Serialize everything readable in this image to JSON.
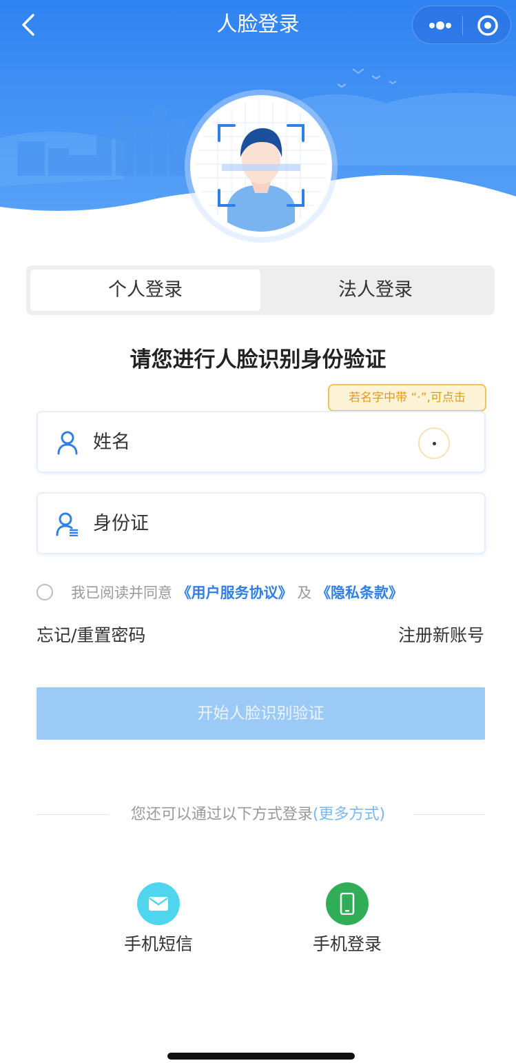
{
  "nav": {
    "title": "人脸登录"
  },
  "tabs": [
    {
      "label": "个人登录",
      "selected": true
    },
    {
      "label": "法人登录",
      "selected": false
    }
  ],
  "heading": "请您进行人脸识别身份验证",
  "tooltip": {
    "text": "若名字中带 “·”,可点击"
  },
  "form": {
    "name_placeholder": "姓名",
    "id_placeholder": "身份证",
    "dot_button": "·"
  },
  "agreement": {
    "prefix": "我已阅读并同意",
    "user_agreement": "《用户服务协议》",
    "and": "及",
    "privacy": "《隐私条款》",
    "checked": false
  },
  "links": {
    "forgot": "忘记/重置密码",
    "register": "注册新账号"
  },
  "start_button": "开始人脸识别验证",
  "other": {
    "text": "您还可以通过以下方式登录",
    "more": "(更多方式)"
  },
  "alt_methods": [
    {
      "label": "手机短信",
      "icon": "envelope-icon",
      "color": "#4fd6ee"
    },
    {
      "label": "手机登录",
      "icon": "mobile-phone-icon",
      "color": "#2fae57"
    }
  ],
  "colors": {
    "header_blue": "#3b8cf0",
    "link_blue": "#2f7fe6",
    "button_disabled": "#9ccaf7"
  }
}
